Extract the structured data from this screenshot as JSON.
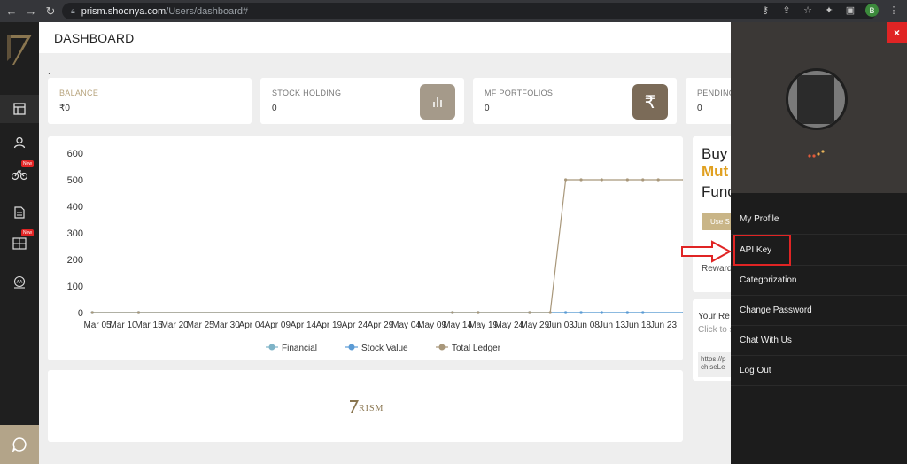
{
  "browser": {
    "url_host": "prism.shoonya.com",
    "url_path": "/Users/dashboard#",
    "profile_initial": "B"
  },
  "page": {
    "title": "DASHBOARD",
    "dot": "."
  },
  "cards": [
    {
      "label": "BALANCE",
      "value": "₹0"
    },
    {
      "label": "STOCK HOLDING",
      "value": "0",
      "icon": "bar-chart-icon"
    },
    {
      "label": "MF PORTFOLIOS",
      "value": "0",
      "icon": "rupee-icon"
    },
    {
      "label": "PENDING",
      "value": "0"
    }
  ],
  "chart_data": {
    "type": "line",
    "categories": [
      "Mar 05",
      "Mar 10",
      "Mar 15",
      "Mar 20",
      "Mar 25",
      "Mar 30",
      "Apr 04",
      "Apr 09",
      "Apr 14",
      "Apr 19",
      "Apr 24",
      "Apr 29",
      "May 04",
      "May 09",
      "May 14",
      "May 19",
      "May 24",
      "May 29",
      "Jun 03",
      "Jun 08",
      "Jun 13",
      "Jun 18",
      "Jun 23"
    ],
    "ylim": [
      0,
      600
    ],
    "yticks": [
      0,
      100,
      200,
      300,
      400,
      500,
      600
    ],
    "series": [
      {
        "name": "Financial",
        "color": "#7eb3c7",
        "points": [
          [
            "Mar 04",
            0
          ],
          [
            "Mar 13",
            0
          ],
          [
            "May 13",
            0
          ],
          [
            "May 18",
            0
          ],
          [
            "May 28",
            0
          ],
          [
            "Jun 04",
            0
          ],
          [
            "Jun 07",
            0
          ],
          [
            "Jun 11",
            0
          ],
          [
            "Jun 16",
            0
          ],
          [
            "Jun 19",
            0
          ],
          [
            "Jun 27",
            0
          ]
        ]
      },
      {
        "name": "Stock Value",
        "color": "#5b9bd5",
        "points": [
          [
            "Mar 04",
            0
          ],
          [
            "Mar 13",
            0
          ],
          [
            "May 13",
            0
          ],
          [
            "May 18",
            0
          ],
          [
            "May 28",
            0
          ],
          [
            "Jun 04",
            0
          ],
          [
            "Jun 07",
            0
          ],
          [
            "Jun 11",
            0
          ],
          [
            "Jun 16",
            0
          ],
          [
            "Jun 19",
            0
          ],
          [
            "Jun 27",
            0
          ]
        ]
      },
      {
        "name": "Total Ledger",
        "color": "#a8977a",
        "points": [
          [
            "Mar 04",
            0
          ],
          [
            "Mar 13",
            0
          ],
          [
            "May 13",
            0
          ],
          [
            "May 18",
            0
          ],
          [
            "May 28",
            0
          ],
          [
            "Jun 01",
            0
          ],
          [
            "Jun 04",
            500
          ],
          [
            "Jun 07",
            500
          ],
          [
            "Jun 11",
            500
          ],
          [
            "Jun 16",
            500
          ],
          [
            "Jun 19",
            500
          ],
          [
            "Jun 22",
            500
          ],
          [
            "Jun 27",
            500
          ]
        ]
      }
    ],
    "legend": "bottom-center"
  },
  "promo": {
    "line1": "Buy",
    "line2": "Mut",
    "line3": "Func",
    "button": "Use S",
    "reward": "Reward",
    "your_ref": "Your Re",
    "click_to": "Click to s",
    "link1": "https://p",
    "link2": "chiseLe"
  },
  "footer_logo": "RISM",
  "user_menu": {
    "close": "×",
    "items": [
      {
        "label": "My Profile"
      },
      {
        "label": "API Key"
      },
      {
        "label": "Categorization"
      },
      {
        "label": "Change Password"
      },
      {
        "label": "Chat With Us"
      },
      {
        "label": "Log Out"
      }
    ]
  },
  "colors": {
    "accent": "#b3a489",
    "highlight": "#e02424",
    "gold": "#e0a020"
  }
}
